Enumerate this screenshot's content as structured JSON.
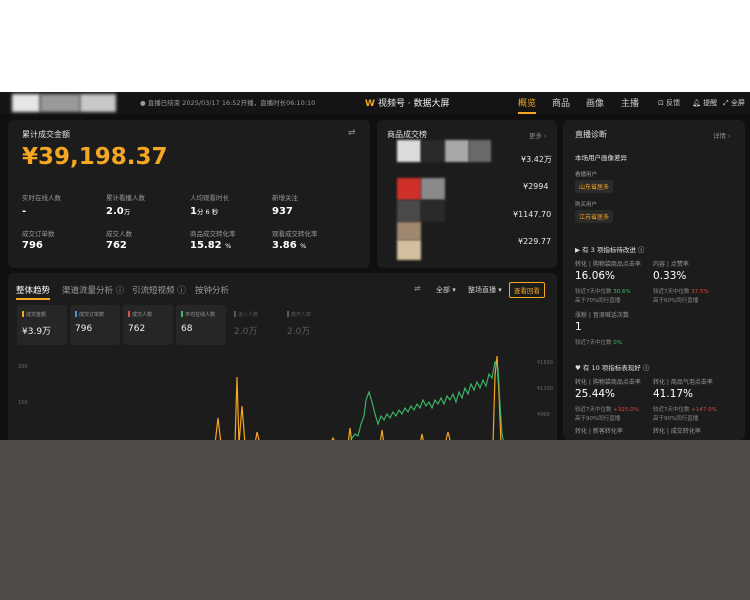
{
  "header": {
    "status": "● 直播已结束 2025/03/17 16:52开播，直播时长06:10:10",
    "brand": "视频号 · 数据大屏",
    "nav": [
      "概览",
      "商品",
      "画像",
      "主播"
    ],
    "actions": [
      "反馈",
      "提醒",
      "全屏"
    ]
  },
  "summary": {
    "title": "累计成交金额",
    "amount": "¥39,198.37",
    "metrics": [
      {
        "label": "实时在线人数",
        "value": "-",
        "unit": ""
      },
      {
        "label": "累计看播人数",
        "value": "2.0",
        "unit": "万"
      },
      {
        "label": "人均观看时长",
        "value": "1",
        "unit": "分 6 秒"
      },
      {
        "label": "新增关注",
        "value": "937",
        "unit": ""
      },
      {
        "label": "成交订单数",
        "value": "796",
        "unit": ""
      },
      {
        "label": "成交人数",
        "value": "762",
        "unit": ""
      },
      {
        "label": "商品成交转化率",
        "value": "15.82",
        "unit": "%"
      },
      {
        "label": "观看成交转化率",
        "value": "3.86",
        "unit": "%"
      }
    ]
  },
  "products": {
    "title": "商品成交榜",
    "more": "更多 ›",
    "prices": [
      "¥3.42万",
      "¥2994",
      "¥1147.70",
      "¥229.77"
    ]
  },
  "trend": {
    "tabs": [
      "整体趋势",
      "渠道流量分析 ⓘ",
      "引流短视频 ⓘ",
      "按钟分析"
    ],
    "filter_all": "全部 ▾",
    "filter_live": "整场直播 ▾",
    "view_btn": "查看回看",
    "kpis": [
      {
        "label": "成交金额",
        "value": "¥3.9万",
        "color": "#f5a623"
      },
      {
        "label": "成交订单数",
        "value": "796",
        "color": "#4a90e2"
      },
      {
        "label": "成交人数",
        "value": "762",
        "color": "#d9534f"
      },
      {
        "label": "平均在线人数",
        "value": "68",
        "color": "#3dbb6a"
      },
      {
        "label": "进入人数",
        "value": "2.0万",
        "color": "#5a5a5a"
      },
      {
        "label": "离开人数",
        "value": "2.0万",
        "color": "#5a5a5a"
      }
    ],
    "y_left": [
      "200",
      "150"
    ],
    "y_right": [
      "¥1500",
      "¥1200",
      "¥900"
    ]
  },
  "diagnosis": {
    "title": "直播诊断",
    "detail": "详情 ›",
    "portrait_title": "本场用户画像差异",
    "region_label": "看播用户",
    "region_value": "山东省居多",
    "buyer_label": "购买用户",
    "buyer_value": "江苏省居多",
    "section1": "▶ 有 3 项指标待改进 ⓘ",
    "s1_metrics": [
      {
        "label": "转化 | 购物袋商品点击率",
        "value": "16.06%",
        "cmp": "较近7天中位数",
        "delta": "30.6%",
        "delta_dir": "up",
        "rank": "高于70%同行直播"
      },
      {
        "label": "内容 | 点赞率",
        "value": "0.33%",
        "cmp": "较近7天中位数",
        "delta": "37.5%",
        "delta_dir": "up",
        "rank": "高于60%同行直播"
      },
      {
        "label": "涨粉 | 音浪喊话次数",
        "value": "1",
        "cmp": "较近7天中位数",
        "delta": "0%",
        "delta_dir": "green",
        "rank": ""
      }
    ],
    "section2": "♥ 有 10 项指标表现好 ⓘ",
    "s2_metrics": [
      {
        "label": "转化 | 购物袋商品点击率",
        "value": "25.44%",
        "cmp": "较近7天中位数",
        "delta": "+325.0%",
        "delta_dir": "up",
        "rank": "高于90%同行直播"
      },
      {
        "label": "转化 | 商品气泡点击率",
        "value": "41.17%",
        "cmp": "较近7天中位数",
        "delta": "+147.0%",
        "delta_dir": "up",
        "rank": "高于90%同行直播"
      }
    ],
    "s2_more": [
      "转化 | 新客转化率",
      "转化 | 成交转化率"
    ]
  }
}
